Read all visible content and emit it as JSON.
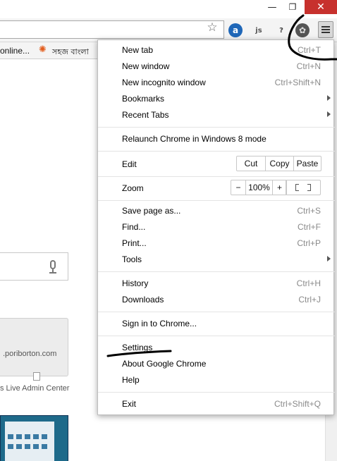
{
  "window": {
    "minimize_glyph": "—",
    "maximize_glyph": "❐",
    "close_glyph": "✕"
  },
  "toolbar": {
    "bookmark_star_icon": "star-icon",
    "extension_a": "a",
    "extension_js": "js",
    "extension_q": "?",
    "extension_film": "✿",
    "menu_icon": "hamburger-icon"
  },
  "bookmarks": {
    "item_1": "online...",
    "item_2": "সহজ বাংলা"
  },
  "page": {
    "tile_url": ".poriborton.com",
    "tile_title": "s Live Admin Center"
  },
  "menu": {
    "new_tab": {
      "label": "New tab",
      "shortcut": "Ctrl+T"
    },
    "new_window": {
      "label": "New window",
      "shortcut": "Ctrl+N"
    },
    "new_incognito": {
      "label": "New incognito window",
      "shortcut": "Ctrl+Shift+N"
    },
    "bookmarks": {
      "label": "Bookmarks"
    },
    "recent_tabs": {
      "label": "Recent Tabs"
    },
    "relaunch": {
      "label": "Relaunch Chrome in Windows 8 mode"
    },
    "edit": {
      "label": "Edit",
      "cut": "Cut",
      "copy": "Copy",
      "paste": "Paste"
    },
    "zoom": {
      "label": "Zoom",
      "minus": "−",
      "level": "100%",
      "plus": "+"
    },
    "save_page": {
      "label": "Save page as...",
      "shortcut": "Ctrl+S"
    },
    "find": {
      "label": "Find...",
      "shortcut": "Ctrl+F"
    },
    "print": {
      "label": "Print...",
      "shortcut": "Ctrl+P"
    },
    "tools": {
      "label": "Tools"
    },
    "history": {
      "label": "History",
      "shortcut": "Ctrl+H"
    },
    "downloads": {
      "label": "Downloads",
      "shortcut": "Ctrl+J"
    },
    "sign_in": {
      "label": "Sign in to Chrome..."
    },
    "settings": {
      "label": "Settings"
    },
    "about": {
      "label": "About Google Chrome"
    },
    "help": {
      "label": "Help"
    },
    "exit": {
      "label": "Exit",
      "shortcut": "Ctrl+Shift+Q"
    }
  },
  "colors": {
    "close_button": "#c7312d",
    "shortcut_text": "#8a8a8a",
    "annotation_ink": "#000000"
  }
}
